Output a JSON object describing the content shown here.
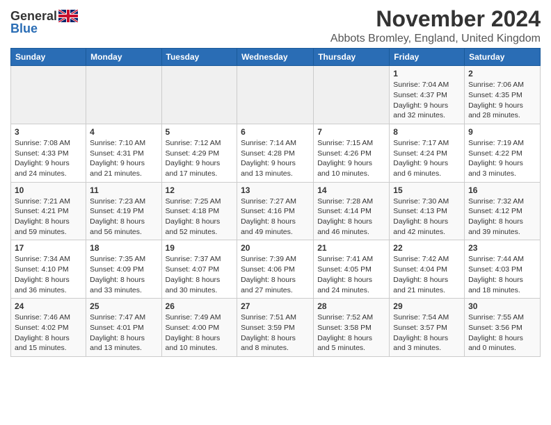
{
  "header": {
    "logo_general": "General",
    "logo_blue": "Blue",
    "title": "November 2024",
    "location": "Abbots Bromley, England, United Kingdom"
  },
  "weekdays": [
    "Sunday",
    "Monday",
    "Tuesday",
    "Wednesday",
    "Thursday",
    "Friday",
    "Saturday"
  ],
  "weeks": [
    [
      {
        "day": "",
        "info": ""
      },
      {
        "day": "",
        "info": ""
      },
      {
        "day": "",
        "info": ""
      },
      {
        "day": "",
        "info": ""
      },
      {
        "day": "",
        "info": ""
      },
      {
        "day": "1",
        "info": "Sunrise: 7:04 AM\nSunset: 4:37 PM\nDaylight: 9 hours\nand 32 minutes."
      },
      {
        "day": "2",
        "info": "Sunrise: 7:06 AM\nSunset: 4:35 PM\nDaylight: 9 hours\nand 28 minutes."
      }
    ],
    [
      {
        "day": "3",
        "info": "Sunrise: 7:08 AM\nSunset: 4:33 PM\nDaylight: 9 hours\nand 24 minutes."
      },
      {
        "day": "4",
        "info": "Sunrise: 7:10 AM\nSunset: 4:31 PM\nDaylight: 9 hours\nand 21 minutes."
      },
      {
        "day": "5",
        "info": "Sunrise: 7:12 AM\nSunset: 4:29 PM\nDaylight: 9 hours\nand 17 minutes."
      },
      {
        "day": "6",
        "info": "Sunrise: 7:14 AM\nSunset: 4:28 PM\nDaylight: 9 hours\nand 13 minutes."
      },
      {
        "day": "7",
        "info": "Sunrise: 7:15 AM\nSunset: 4:26 PM\nDaylight: 9 hours\nand 10 minutes."
      },
      {
        "day": "8",
        "info": "Sunrise: 7:17 AM\nSunset: 4:24 PM\nDaylight: 9 hours\nand 6 minutes."
      },
      {
        "day": "9",
        "info": "Sunrise: 7:19 AM\nSunset: 4:22 PM\nDaylight: 9 hours\nand 3 minutes."
      }
    ],
    [
      {
        "day": "10",
        "info": "Sunrise: 7:21 AM\nSunset: 4:21 PM\nDaylight: 8 hours\nand 59 minutes."
      },
      {
        "day": "11",
        "info": "Sunrise: 7:23 AM\nSunset: 4:19 PM\nDaylight: 8 hours\nand 56 minutes."
      },
      {
        "day": "12",
        "info": "Sunrise: 7:25 AM\nSunset: 4:18 PM\nDaylight: 8 hours\nand 52 minutes."
      },
      {
        "day": "13",
        "info": "Sunrise: 7:27 AM\nSunset: 4:16 PM\nDaylight: 8 hours\nand 49 minutes."
      },
      {
        "day": "14",
        "info": "Sunrise: 7:28 AM\nSunset: 4:14 PM\nDaylight: 8 hours\nand 46 minutes."
      },
      {
        "day": "15",
        "info": "Sunrise: 7:30 AM\nSunset: 4:13 PM\nDaylight: 8 hours\nand 42 minutes."
      },
      {
        "day": "16",
        "info": "Sunrise: 7:32 AM\nSunset: 4:12 PM\nDaylight: 8 hours\nand 39 minutes."
      }
    ],
    [
      {
        "day": "17",
        "info": "Sunrise: 7:34 AM\nSunset: 4:10 PM\nDaylight: 8 hours\nand 36 minutes."
      },
      {
        "day": "18",
        "info": "Sunrise: 7:35 AM\nSunset: 4:09 PM\nDaylight: 8 hours\nand 33 minutes."
      },
      {
        "day": "19",
        "info": "Sunrise: 7:37 AM\nSunset: 4:07 PM\nDaylight: 8 hours\nand 30 minutes."
      },
      {
        "day": "20",
        "info": "Sunrise: 7:39 AM\nSunset: 4:06 PM\nDaylight: 8 hours\nand 27 minutes."
      },
      {
        "day": "21",
        "info": "Sunrise: 7:41 AM\nSunset: 4:05 PM\nDaylight: 8 hours\nand 24 minutes."
      },
      {
        "day": "22",
        "info": "Sunrise: 7:42 AM\nSunset: 4:04 PM\nDaylight: 8 hours\nand 21 minutes."
      },
      {
        "day": "23",
        "info": "Sunrise: 7:44 AM\nSunset: 4:03 PM\nDaylight: 8 hours\nand 18 minutes."
      }
    ],
    [
      {
        "day": "24",
        "info": "Sunrise: 7:46 AM\nSunset: 4:02 PM\nDaylight: 8 hours\nand 15 minutes."
      },
      {
        "day": "25",
        "info": "Sunrise: 7:47 AM\nSunset: 4:01 PM\nDaylight: 8 hours\nand 13 minutes."
      },
      {
        "day": "26",
        "info": "Sunrise: 7:49 AM\nSunset: 4:00 PM\nDaylight: 8 hours\nand 10 minutes."
      },
      {
        "day": "27",
        "info": "Sunrise: 7:51 AM\nSunset: 3:59 PM\nDaylight: 8 hours\nand 8 minutes."
      },
      {
        "day": "28",
        "info": "Sunrise: 7:52 AM\nSunset: 3:58 PM\nDaylight: 8 hours\nand 5 minutes."
      },
      {
        "day": "29",
        "info": "Sunrise: 7:54 AM\nSunset: 3:57 PM\nDaylight: 8 hours\nand 3 minutes."
      },
      {
        "day": "30",
        "info": "Sunrise: 7:55 AM\nSunset: 3:56 PM\nDaylight: 8 hours\nand 0 minutes."
      }
    ]
  ]
}
